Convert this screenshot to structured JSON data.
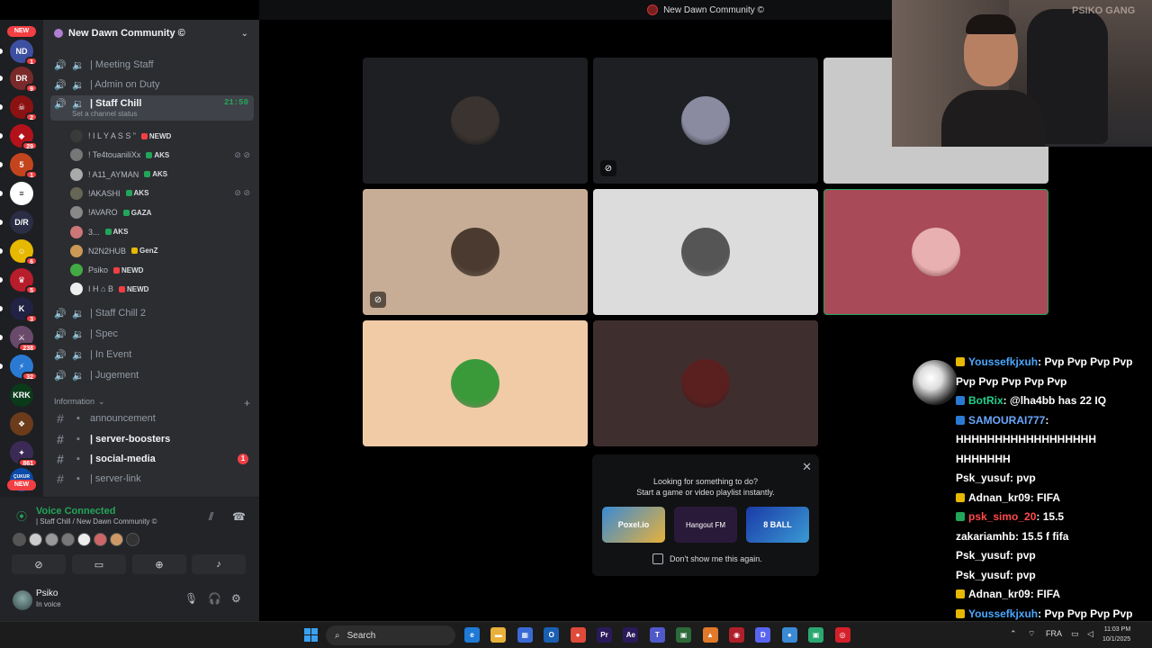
{
  "window": {
    "title": "New Dawn Community ©"
  },
  "server": {
    "name": "New Dawn Community ©"
  },
  "rail": {
    "new_label": "NEW",
    "servers": [
      {
        "icon": "ND",
        "color": "#3d4fa0",
        "badge": "1"
      },
      {
        "icon": "DR",
        "color": "#7a2a2a",
        "badge": "9"
      },
      {
        "icon": "☠",
        "color": "#8b1212",
        "badge": "2"
      },
      {
        "icon": "◆",
        "color": "#b3121b",
        "badge": "29"
      },
      {
        "icon": "5",
        "color": "#c4451d",
        "badge": "1"
      },
      {
        "icon": "≡",
        "color": "#ffffff",
        "badge": ""
      },
      {
        "icon": "D/R",
        "color": "#2b2d45",
        "badge": ""
      },
      {
        "icon": "☺",
        "color": "#e6b800",
        "badge": "6"
      },
      {
        "icon": "♛",
        "color": "#b81d2c",
        "badge": "5"
      },
      {
        "icon": "K",
        "color": "#222244",
        "badge": "3"
      },
      {
        "icon": "⚔",
        "color": "#6a4a6a",
        "badge": "238"
      },
      {
        "icon": "⚡",
        "color": "#2a7ad4",
        "badge": "32"
      },
      {
        "icon": "KRK",
        "color": "#0a3a1a",
        "badge": ""
      },
      {
        "icon": "❖",
        "color": "#6b3b1b",
        "badge": ""
      },
      {
        "icon": "✦",
        "color": "#3a2a55",
        "badge": "861"
      },
      {
        "icon": "ÇUKUR SPOR",
        "color": "#0a4aa8",
        "badge": ""
      }
    ]
  },
  "channels": {
    "voice_top": [
      {
        "label": "| Meeting Staff"
      },
      {
        "label": "| Admin on Duty"
      }
    ],
    "active": {
      "label": "| Staff Chill",
      "time": "21:50",
      "status": "Set a channel status"
    },
    "members": [
      {
        "name": "! I L Y A S S ”",
        "tag": "NEWD",
        "tag_color": "#f23f43",
        "muted": false
      },
      {
        "name": "! Te4touaniliXx",
        "tag": "AKS",
        "tag_color": "#23a559",
        "muted": true
      },
      {
        "name": "! A11_AYMAN",
        "tag": "AKS",
        "tag_color": "#23a559",
        "muted": false
      },
      {
        "name": "!AKASHI",
        "tag": "AKS",
        "tag_color": "#23a559",
        "muted": true
      },
      {
        "name": "!AVARO",
        "tag": "GAZA",
        "tag_color": "#23a559",
        "muted": false
      },
      {
        "name": "3...",
        "tag": "AKS",
        "tag_color": "#23a559",
        "muted": false
      },
      {
        "name": "N2N2HUB",
        "tag": "GenZ",
        "tag_color": "#e6b800",
        "muted": false
      },
      {
        "name": "Psiko",
        "tag": "NEWD",
        "tag_color": "#f23f43",
        "muted": false
      },
      {
        "name": "I H ⌂ B",
        "tag": "NEWD",
        "tag_color": "#f23f43",
        "muted": false
      }
    ],
    "voice_bottom": [
      {
        "label": "| Staff Chill 2"
      },
      {
        "label": "| Spec"
      },
      {
        "label": "| In Event"
      },
      {
        "label": "| Jugement"
      }
    ],
    "category": "Information",
    "text": [
      {
        "label": "announcement",
        "bold": false,
        "unread": ""
      },
      {
        "label": "| server-boosters",
        "bold": true,
        "unread": ""
      },
      {
        "label": "| social-media",
        "bold": true,
        "unread": "1"
      },
      {
        "label": "| server-link",
        "bold": false,
        "unread": ""
      }
    ]
  },
  "voice_panel": {
    "title": "Voice Connected",
    "subtitle": "| Staff Chill / New Dawn Community ©"
  },
  "user": {
    "name": "Psiko",
    "status": "In voice"
  },
  "grid": {
    "tiles": [
      {
        "bg": "#1e1f22",
        "avatar": "#3a3330",
        "pin": false
      },
      {
        "bg": "#1e1f22",
        "avatar": "#8a8aa0",
        "pin": true
      },
      {
        "bg": "#c9c9c9",
        "avatar": "#d04050",
        "pin": false
      },
      {
        "bg": "#c8ad96",
        "avatar": "#4a3a30",
        "pin": true
      },
      {
        "bg": "#dcdcdc",
        "avatar": "#555555",
        "pin": false
      },
      {
        "bg": "#a84a58",
        "avatar": "#e8b0b0",
        "pin": false
      },
      {
        "bg": "#f0cba6",
        "avatar": "#3a9a3a",
        "pin": false
      },
      {
        "bg": "#3e2f2e",
        "avatar": "#5a2020",
        "pin": false
      },
      {
        "bg": "#000000",
        "avatar": "#000000",
        "pin": false
      }
    ]
  },
  "activity": {
    "line1": "Looking for something to do?",
    "line2": "Start a game or video playlist instantly.",
    "games": [
      "Poxel.io",
      "Hangout FM",
      "8 BALL"
    ],
    "checkbox": "Don't show me this again."
  },
  "webcam": {
    "sign": "PSIKO GANG"
  },
  "chat": [
    {
      "user": "Youssefkjxuh",
      "color": "#4aa8ff",
      "badge": "#e6b800",
      "msg": ": Pvp Pvp Pvp Pvp Pvp Pvp Pvp Pvp Pvp"
    },
    {
      "user": "BotRix",
      "color": "#23d18b",
      "badge": "#2a7ad4",
      "msg": ": @lha4bb has 22 IQ"
    },
    {
      "user": "SAMOURAI777",
      "color": "#6aa7ff",
      "badge": "#2a7ad4",
      "msg": ": HHHHHHHHHHHHHHHHHH HHHHHHH"
    },
    {
      "user": "Psk_yusuf",
      "color": "#ffffff",
      "badge": "",
      "msg": ": pvp"
    },
    {
      "user": "Adnan_kr09",
      "color": "#ffffff",
      "badge": "#e6b800",
      "msg": ": FIFA"
    },
    {
      "user": "psk_simo_20",
      "color": "#ff4a4a",
      "badge": "#23a559",
      "msg": ": 15.5"
    },
    {
      "user": "zakariamhb",
      "color": "#ffffff",
      "badge": "",
      "msg": ": 15.5 f fifa"
    },
    {
      "user": "Psk_yusuf",
      "color": "#ffffff",
      "badge": "",
      "msg": ": pvp"
    },
    {
      "user": "Psk_yusuf",
      "color": "#ffffff",
      "badge": "",
      "msg": ": pvp"
    },
    {
      "user": "Adnan_kr09",
      "color": "#ffffff",
      "badge": "#e6b800",
      "msg": ": FIFA"
    },
    {
      "user": "Youssefkjxuh",
      "color": "#4aa8ff",
      "badge": "#e6b800",
      "msg": ": Pvp Pvp Pvp Pvp Pvp Pvp Pvp Pvp Pvp Pvp Pvp Pvp Pvp Pvp"
    }
  ],
  "taskbar": {
    "search": "Search",
    "apps": [
      {
        "icon": "e",
        "color": "#1f7ad6"
      },
      {
        "icon": "▬",
        "color": "#e8b13a"
      },
      {
        "icon": "▦",
        "color": "#3a6ad4"
      },
      {
        "icon": "O",
        "color": "#1a5fb4"
      },
      {
        "icon": "●",
        "color": "#e04a3a"
      },
      {
        "icon": "Pr",
        "color": "#2a1a5a"
      },
      {
        "icon": "Ae",
        "color": "#2a1a5a"
      },
      {
        "icon": "T",
        "color": "#5059c9"
      },
      {
        "icon": "▣",
        "color": "#2d6a3a"
      },
      {
        "icon": "▲",
        "color": "#e07a2a"
      },
      {
        "icon": "◉",
        "color": "#b0202a"
      },
      {
        "icon": "D",
        "color": "#5865f2"
      },
      {
        "icon": "●",
        "color": "#3a8ad4"
      },
      {
        "icon": "▣",
        "color": "#2aa870"
      },
      {
        "icon": "◎",
        "color": "#d4202a"
      }
    ],
    "lang": "FRA",
    "time": "11:03 PM",
    "date": "10/1/2025"
  }
}
